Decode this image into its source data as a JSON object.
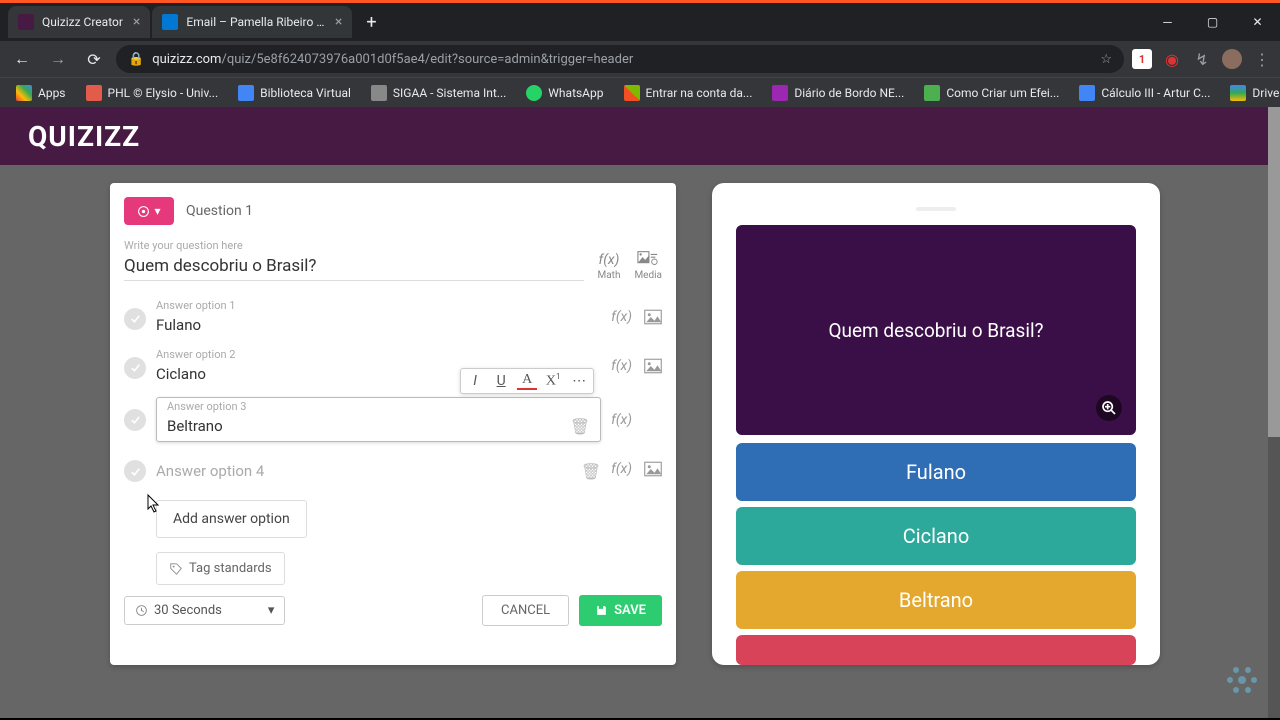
{
  "browser": {
    "tabs": [
      {
        "title": "Quizizz Creator",
        "favicon_bg": "#461a42"
      },
      {
        "title": "Email – Pamella Ribeiro – Outlo...",
        "favicon_bg": "#0078d4"
      }
    ],
    "url_prefix": "quizizz.com",
    "url_rest": "/quiz/5e8f624073976a001d0f5ae4/edit?source=admin&trigger=header",
    "bookmarks": [
      {
        "label": "Apps",
        "color": "#dadce0"
      },
      {
        "label": "PHL © Elysio - Univ...",
        "color": "#e25b4b"
      },
      {
        "label": "Biblioteca Virtual",
        "color": "#4285f4"
      },
      {
        "label": "SIGAA - Sistema Int...",
        "color": "#888"
      },
      {
        "label": "WhatsApp",
        "color": "#25d366"
      },
      {
        "label": "Entrar na conta da...",
        "color": ""
      },
      {
        "label": "Diário de Bordo NE...",
        "color": "#9c27b0"
      },
      {
        "label": "Como Criar um Efei...",
        "color": "#4caf50"
      },
      {
        "label": "Cálculo III - Artur C...",
        "color": "#4285f4"
      },
      {
        "label": "Drive EMA",
        "color": ""
      }
    ]
  },
  "editor": {
    "logo": "QUIZIZZ",
    "question_number": "Question 1",
    "question_label": "Write your question here",
    "question_text": "Quem descobriu o Brasil?",
    "math_label": "Math",
    "media_label": "Media",
    "options": [
      {
        "label": "Answer option 1",
        "value": "Fulano",
        "fx": true,
        "img": true
      },
      {
        "label": "Answer option 2",
        "value": "Ciclano",
        "fx": true,
        "img": true
      },
      {
        "label": "Answer option 3",
        "value": "Beltrano",
        "fx": true,
        "img": false,
        "active": true
      },
      {
        "label": "Answer option 4",
        "value": "",
        "placeholder": "Answer option 4",
        "fx": true,
        "img": true
      }
    ],
    "add_option": "Add answer option",
    "tag_standards": "Tag standards",
    "time": "30 Seconds",
    "cancel": "CANCEL",
    "save": "SAVE"
  },
  "preview": {
    "question": "Quem descobriu o Brasil?",
    "answers": [
      "Fulano",
      "Ciclano",
      "Beltrano"
    ]
  }
}
